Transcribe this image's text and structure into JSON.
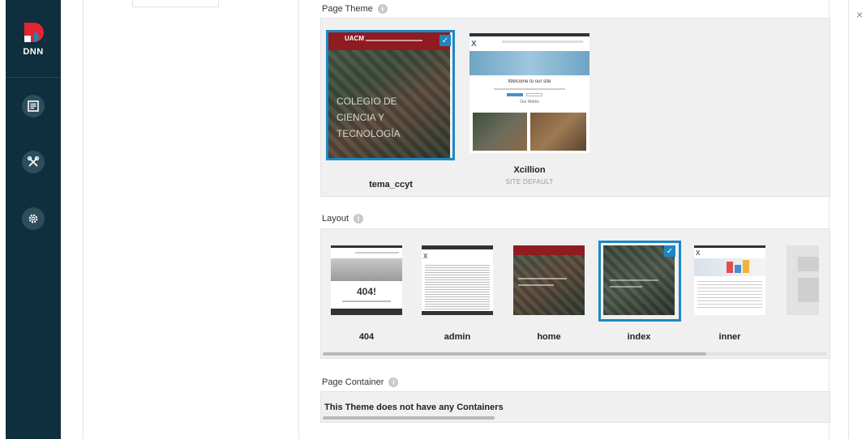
{
  "sidebar": {
    "logo_text": "DNN",
    "items": [
      {
        "icon": "page-icon"
      },
      {
        "icon": "tools-icon"
      },
      {
        "icon": "gear-icon"
      }
    ]
  },
  "close_label": "×",
  "page_theme": {
    "label": "Page Theme",
    "info": "i",
    "themes": [
      {
        "name": "tema_ccyt",
        "subtitle": "",
        "selected": true,
        "thumb_title": "COLEGIO DE CIENCIA Y TECNOLOGÍA",
        "thumb_brand": "UACM"
      },
      {
        "name": "Xcillion",
        "subtitle": "SITE DEFAULT",
        "selected": false,
        "thumb_heading": "Welcome to our site",
        "thumb_link": "Our Works"
      }
    ]
  },
  "layout": {
    "label": "Layout",
    "info": "i",
    "items": [
      {
        "name": "404",
        "selected": false,
        "thumb_text": "404!"
      },
      {
        "name": "admin",
        "selected": false
      },
      {
        "name": "home",
        "selected": false
      },
      {
        "name": "index",
        "selected": true
      },
      {
        "name": "inner",
        "selected": false
      }
    ],
    "scroll_fraction": 0.76
  },
  "page_container": {
    "label": "Page Container",
    "info": "i",
    "message": "This Theme does not have any Containers"
  },
  "colors": {
    "sidebar": "#0f2e3e",
    "accent": "#1e87c3"
  }
}
